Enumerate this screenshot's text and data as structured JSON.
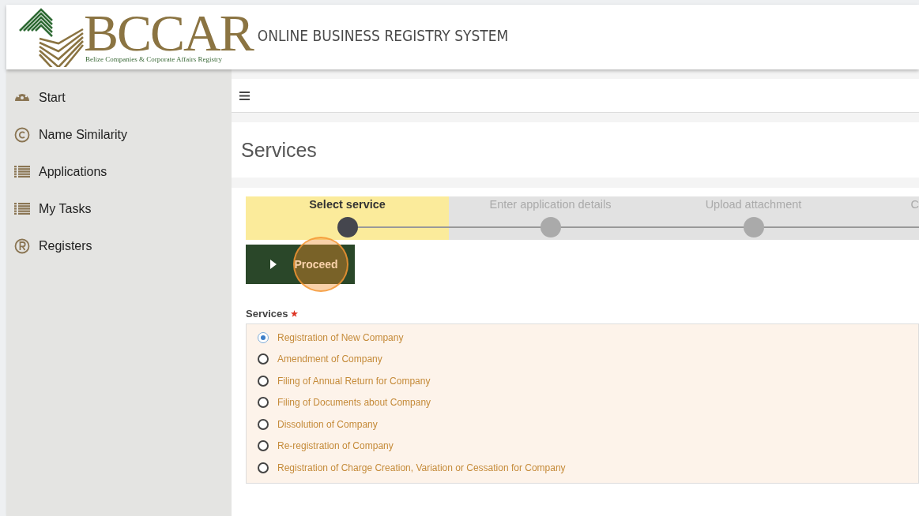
{
  "header": {
    "logo_text": "BCCAR",
    "logo_subtitle": "Belize Companies & Corporate Affairs Registry",
    "title": "ONLINE BUSINESS REGISTRY SYSTEM"
  },
  "sidebar": {
    "items": [
      {
        "label": "Start",
        "kind": "dashboard"
      },
      {
        "label": "Name Similarity",
        "kind": "copyright"
      },
      {
        "label": "Applications",
        "kind": "list"
      },
      {
        "label": "My Tasks",
        "kind": "list"
      },
      {
        "label": "Registers",
        "kind": "registered"
      }
    ]
  },
  "page": {
    "title": "Services"
  },
  "stepper": {
    "steps": [
      {
        "label": "Select service",
        "selected": true
      },
      {
        "label": "Enter application details",
        "selected": false
      },
      {
        "label": "Upload attachment",
        "selected": false
      },
      {
        "label": "C",
        "selected": false
      }
    ]
  },
  "proceed_button": {
    "label": "Proceed"
  },
  "services": {
    "label": "Services",
    "required": true,
    "options": [
      {
        "label": "Registration of New Company",
        "selected": true
      },
      {
        "label": "Amendment of Company",
        "selected": false
      },
      {
        "label": "Filing of Annual Return for Company",
        "selected": false
      },
      {
        "label": "Filing of Documents about Company",
        "selected": false
      },
      {
        "label": "Dissolution of Company",
        "selected": false
      },
      {
        "label": "Re-registration of Company",
        "selected": false
      },
      {
        "label": "Registration of Charge Creation, Variation or Cessation for Company",
        "selected": false
      }
    ]
  }
}
